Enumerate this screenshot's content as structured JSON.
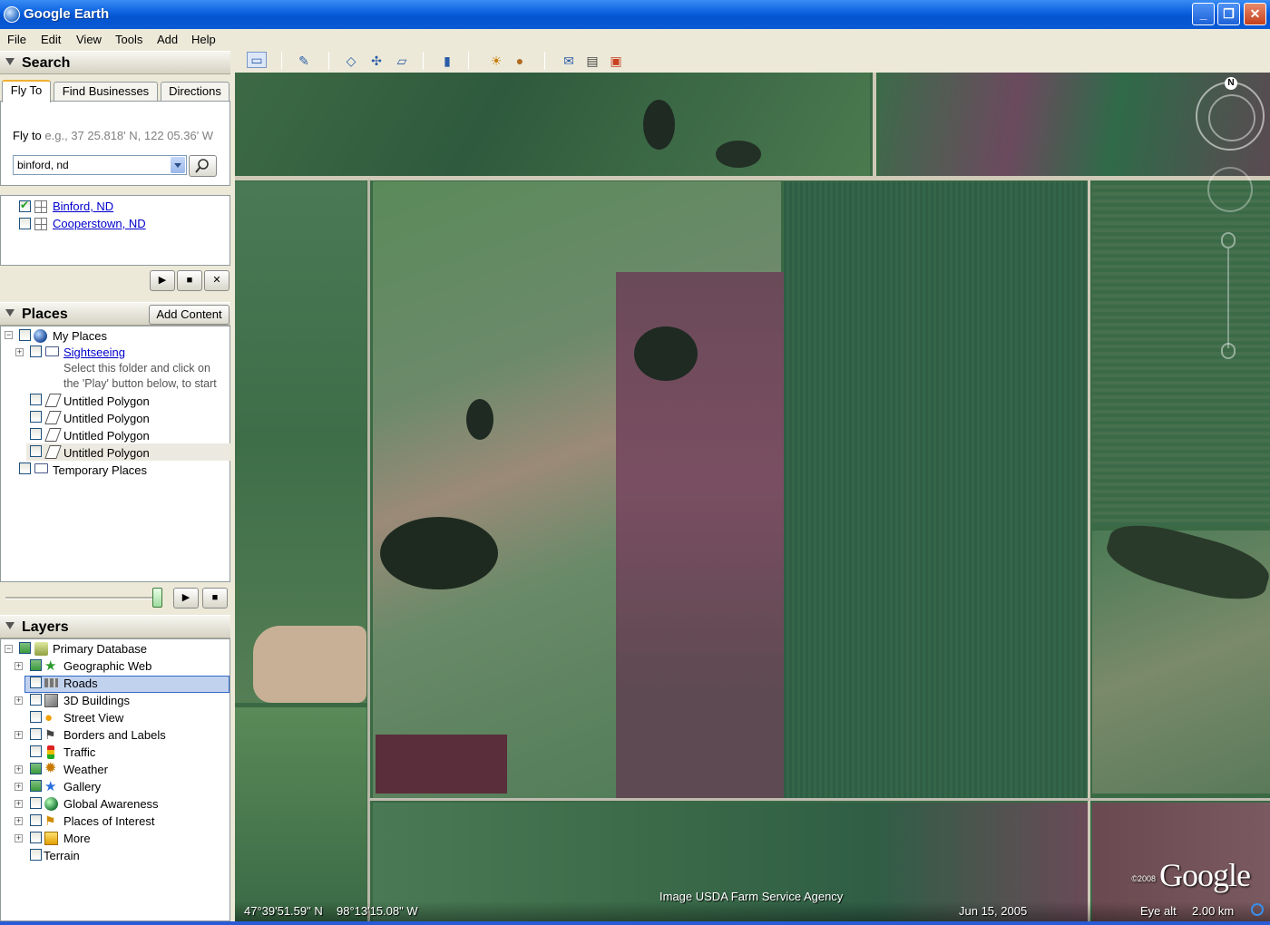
{
  "window": {
    "title": "Google Earth",
    "min": "_",
    "max": "❐",
    "close": "✕"
  },
  "menu": [
    "File",
    "Edit",
    "View",
    "Tools",
    "Add",
    "Help"
  ],
  "search": {
    "header": "Search",
    "tabs": [
      "Fly To",
      "Find Businesses",
      "Directions"
    ],
    "flyto_label": "Fly to",
    "flyto_hint": "e.g., 37 25.818' N, 122 05.36' W",
    "input_value": "binford, nd",
    "results": [
      "Binford, ND",
      "Cooperstown, ND"
    ]
  },
  "places": {
    "header": "Places",
    "add_content": "Add Content",
    "my_places": "My Places",
    "sightseeing": "Sightseeing",
    "hint1": "Select this folder and click on",
    "hint2": "the 'Play' button below, to start",
    "polygons": [
      "Untitled Polygon",
      "Untitled Polygon",
      "Untitled Polygon",
      "Untitled Polygon"
    ],
    "temporary": "Temporary Places"
  },
  "layers": {
    "header": "Layers",
    "items": [
      "Primary Database",
      "Geographic Web",
      "Roads",
      "3D Buildings",
      "Street View",
      "Borders and Labels",
      "Traffic",
      "Weather",
      "Gallery",
      "Global Awareness",
      "Places of Interest",
      "More",
      "Terrain"
    ]
  },
  "map": {
    "credit": "Image USDA Farm Service Agency",
    "lat": "47°39'51.59\" N",
    "lon": "98°13'15.08\" W",
    "date": "Jun 15, 2005",
    "eye_label": "Eye alt",
    "eye_value": "2.00 km",
    "watermark": "Google",
    "copyright": "©2008",
    "north": "N"
  },
  "colors": {
    "title_bar": "#0a5fde",
    "selection": "#c1d2ee",
    "link": "#0000cc"
  }
}
